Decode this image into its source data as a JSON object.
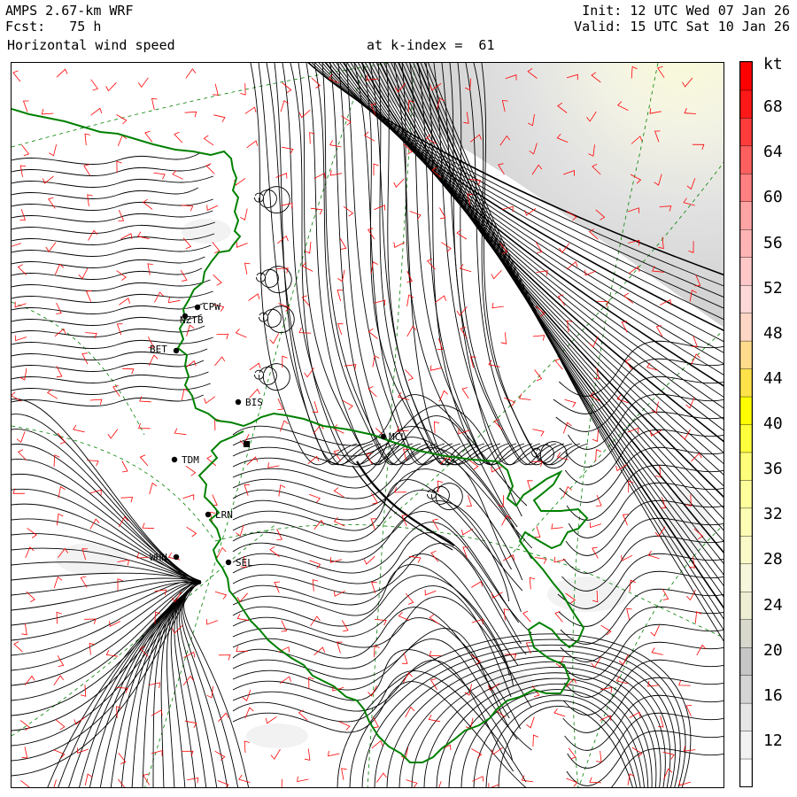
{
  "header": {
    "line1": "AMPS 2.67-km WRF",
    "line2": "Fcst:   75 h",
    "line3": "Horizontal wind speed",
    "init": "Init: 12 UTC Wed 07 Jan 26",
    "valid": "Valid: 15 UTC Sat 10 Jan 26",
    "kindex": "at k-index =  61"
  },
  "colorbar": {
    "unit": "kt",
    "labels": [
      "68",
      "64",
      "60",
      "56",
      "52",
      "48",
      "44",
      "40",
      "36",
      "32",
      "28",
      "24",
      "20",
      "16",
      "12"
    ],
    "colors": [
      "#ffffff",
      "#f2f2f2",
      "#e6e6e6",
      "#d4d4d4",
      "#c6c6c6",
      "#d8d8cc",
      "#eeeed4",
      "#f6f6dc",
      "#fafac8",
      "#fcfcb4",
      "#fefe9c",
      "#fefe7a",
      "#fefe3c",
      "#fefe00",
      "#fee24a",
      "#fedc8c",
      "#fed6c6",
      "#fed8d8",
      "#fec8c8",
      "#feb4b4",
      "#fea4a4",
      "#fe8080",
      "#fe6060",
      "#fe3c3c",
      "#fe1818",
      "#ff0000"
    ],
    "bins_min_kt": 8,
    "bins_max_kt": 72
  },
  "stations": [
    {
      "code": "CPW"
    },
    {
      "code": "NZTB"
    },
    {
      "code": "BET"
    },
    {
      "code": "BIS"
    },
    {
      "code": "MCL"
    },
    {
      "code": "TDM"
    },
    {
      "code": "LRN"
    },
    {
      "code": "WHN"
    },
    {
      "code": "SEL"
    }
  ],
  "map_colors": {
    "coastline": "#008000",
    "wind_barbs": "#ff0000",
    "streamlines": "#000000",
    "graticule": "#008000"
  }
}
